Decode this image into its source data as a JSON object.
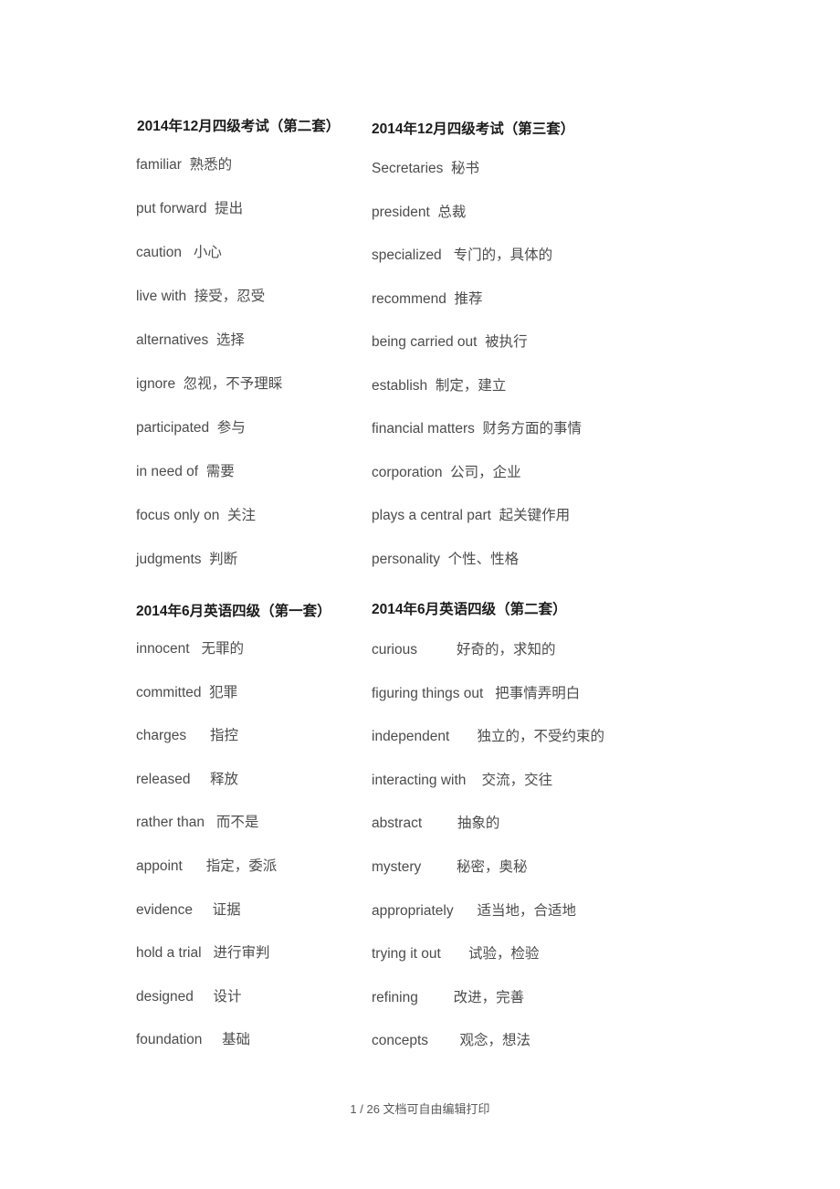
{
  "document": {
    "background_color": "#ffffff",
    "text_color": "#4c4c4c",
    "heading_color": "#1c1c1c"
  },
  "sections": {
    "dec2014_set2": {
      "heading": "2014年12月四级考试（第二套）",
      "entries": [
        {
          "en": "familiar",
          "gap": "  ",
          "zh": "熟悉的"
        },
        {
          "en": "put forward",
          "gap": "  ",
          "zh": "提出"
        },
        {
          "en": "caution",
          "gap": "   ",
          "zh": "小心"
        },
        {
          "en": "live with",
          "gap": "  ",
          "zh": "接受，忍受"
        },
        {
          "en": "alternatives",
          "gap": "  ",
          "zh": "选择"
        },
        {
          "en": "ignore",
          "gap": "  ",
          "zh": "忽视，不予理睬"
        },
        {
          "en": "participated",
          "gap": "  ",
          "zh": "参与"
        },
        {
          "en": "in need of",
          "gap": "  ",
          "zh": "需要"
        },
        {
          "en": "focus only on",
          "gap": "  ",
          "zh": "关注"
        },
        {
          "en": "judgments",
          "gap": "  ",
          "zh": "判断"
        }
      ]
    },
    "dec2014_set3": {
      "heading": "2014年12月四级考试（第三套）",
      "entries": [
        {
          "en": "Secretaries",
          "gap": "  ",
          "zh": "秘书"
        },
        {
          "en": "president",
          "gap": "  ",
          "zh": "总裁"
        },
        {
          "en": "specialized",
          "gap": "   ",
          "zh": "专门的，具体的"
        },
        {
          "en": "recommend",
          "gap": "  ",
          "zh": "推荐"
        },
        {
          "en": "being carried out",
          "gap": "  ",
          "zh": "被执行"
        },
        {
          "en": "establish",
          "gap": "  ",
          "zh": "制定，建立"
        },
        {
          "en": "financial matters",
          "gap": "  ",
          "zh": "财务方面的事情"
        },
        {
          "en": "corporation",
          "gap": "  ",
          "zh": "公司，企业"
        },
        {
          "en": "plays a central part",
          "gap": "  ",
          "zh": "起关键作用"
        },
        {
          "en": "personality",
          "gap": "  ",
          "zh": "个性、性格"
        }
      ]
    },
    "jun2014_set1": {
      "heading": "2014年6月英语四级（第一套）",
      "entries": [
        {
          "en": "innocent",
          "gap": "   ",
          "zh": "无罪的"
        },
        {
          "en": "committed",
          "gap": "  ",
          "zh": "犯罪"
        },
        {
          "en": "charges",
          "gap": "      ",
          "zh": "指控"
        },
        {
          "en": "released",
          "gap": "     ",
          "zh": "释放"
        },
        {
          "en": "rather than",
          "gap": "   ",
          "zh": "而不是"
        },
        {
          "en": "appoint",
          "gap": "      ",
          "zh": "指定，委派"
        },
        {
          "en": "evidence",
          "gap": "     ",
          "zh": "证据"
        },
        {
          "en": "hold a trial",
          "gap": "   ",
          "zh": "进行审判"
        },
        {
          "en": "designed",
          "gap": "     ",
          "zh": "设计"
        },
        {
          "en": "foundation",
          "gap": "     ",
          "zh": "基础"
        }
      ]
    },
    "jun2014_set2": {
      "heading": "2014年6月英语四级（第二套）",
      "entries": [
        {
          "en": "curious",
          "gap": "          ",
          "zh": "好奇的，求知的"
        },
        {
          "en": "figuring things out",
          "gap": "   ",
          "zh": "把事情弄明白"
        },
        {
          "en": "independent",
          "gap": "       ",
          "zh": "独立的，不受约束的"
        },
        {
          "en": "interacting with",
          "gap": "    ",
          "zh": "交流，交往"
        },
        {
          "en": "abstract",
          "gap": "         ",
          "zh": "抽象的"
        },
        {
          "en": "mystery",
          "gap": "         ",
          "zh": "秘密，奥秘"
        },
        {
          "en": "appropriately",
          "gap": "      ",
          "zh": "适当地，合适地"
        },
        {
          "en": "trying it out",
          "gap": "       ",
          "zh": "试验，检验"
        },
        {
          "en": "refining",
          "gap": "         ",
          "zh": "改进，完善"
        },
        {
          "en": "concepts",
          "gap": "        ",
          "zh": "观念，想法"
        }
      ]
    }
  },
  "footer": {
    "text": "1 / 26 文档可自由编辑打印",
    "page_current": "1",
    "page_total": "26",
    "note": "文档可自由编辑打印"
  }
}
